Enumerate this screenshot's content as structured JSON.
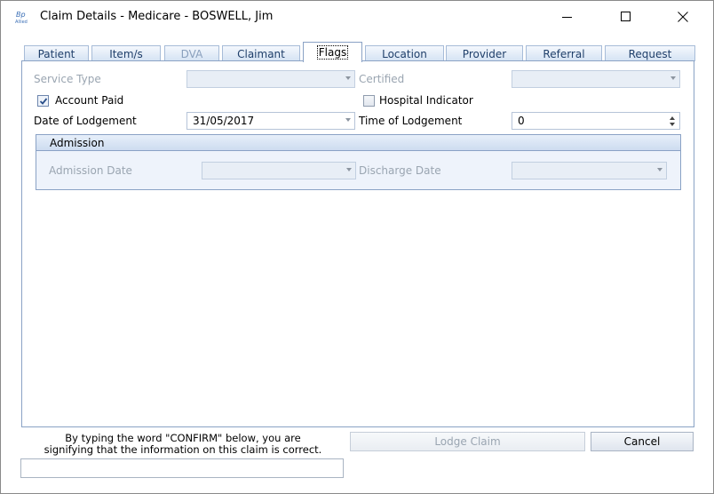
{
  "window": {
    "title": "Claim Details - Medicare - BOSWELL, Jim"
  },
  "tabs": [
    {
      "label": "Patient",
      "state": "normal"
    },
    {
      "label": "Item/s",
      "state": "normal"
    },
    {
      "label": "DVA",
      "state": "disabled"
    },
    {
      "label": "Claimant",
      "state": "normal"
    },
    {
      "label": "Flags",
      "state": "active"
    },
    {
      "label": "Location",
      "state": "normal"
    },
    {
      "label": "Provider",
      "state": "normal"
    },
    {
      "label": "Referral",
      "state": "normal"
    },
    {
      "label": "Request",
      "state": "normal"
    }
  ],
  "flags": {
    "service_type_label": "Service Type",
    "service_type_value": "",
    "certified_label": "Certified",
    "certified_value": "",
    "account_paid_label": "Account Paid",
    "account_paid_checked": true,
    "hospital_indicator_label": "Hospital Indicator",
    "hospital_indicator_checked": false,
    "date_of_lodgement_label": "Date of Lodgement",
    "date_of_lodgement_value": "31/05/2017",
    "time_of_lodgement_label": "Time of Lodgement",
    "time_of_lodgement_value": "0"
  },
  "admission": {
    "title": "Admission",
    "admission_date_label": "Admission Date",
    "admission_date_value": "",
    "discharge_date_label": "Discharge Date",
    "discharge_date_value": ""
  },
  "footer": {
    "confirm_line1": "By typing the word \"CONFIRM\" below, you are",
    "confirm_line2": "signifying that the information on this claim is correct.",
    "confirm_input_value": "",
    "lodge_claim_label": "Lodge Claim",
    "cancel_label": "Cancel"
  },
  "colors": {
    "accent_border": "#8aa2c5",
    "tab_text": "#1f3f6a",
    "disabled_text": "#9aa5b1"
  }
}
